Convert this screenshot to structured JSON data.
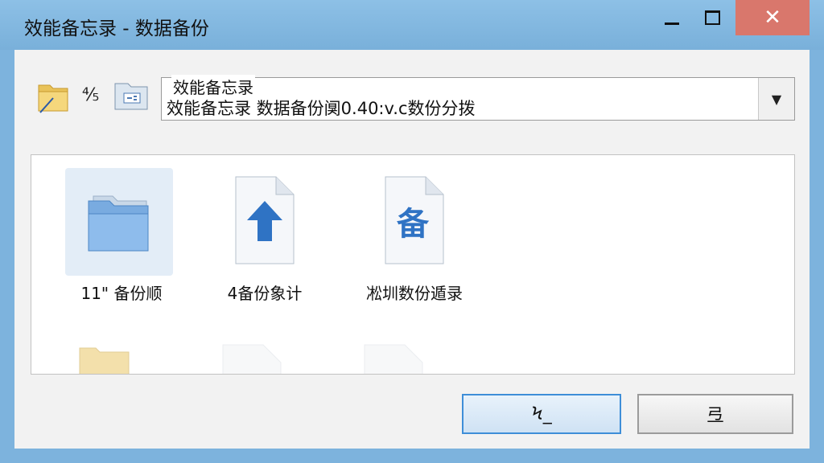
{
  "window": {
    "title": "效能备忘录 - 数据备份"
  },
  "toolbar": {
    "fraction_label": "⅘"
  },
  "address_combo": {
    "label": "效能备忘录",
    "value": "效能备忘录 数据备份阒0.40:v.c数份分拨"
  },
  "items": [
    {
      "label": "11\" 备份顺",
      "icon": "folder-icon"
    },
    {
      "label": "4备份象计",
      "icon": "upload-document-icon"
    },
    {
      "label": "凇圳数份遁录",
      "icon": "backup-document-icon",
      "glyph": "备"
    }
  ],
  "buttons": {
    "primary_label": "Ϟ_",
    "secondary_label": "弖"
  },
  "colors": {
    "titlebar": "#7db3dd",
    "close": "#d9776c",
    "accent": "#3e8ed8",
    "arrow": "#2f73c4"
  }
}
